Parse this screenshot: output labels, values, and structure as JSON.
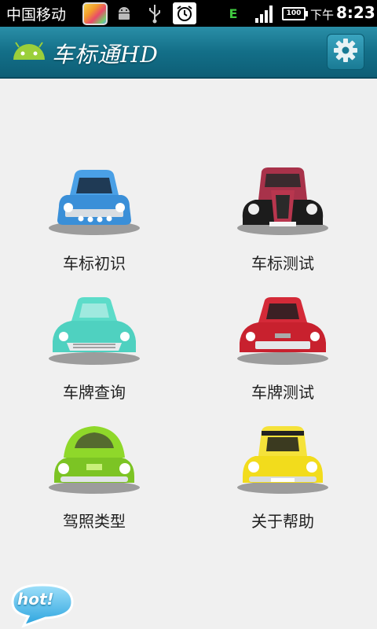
{
  "status_bar": {
    "carrier": "中国移动",
    "network_type": "E",
    "battery_label": "100",
    "time_prefix": "下午",
    "time": "8:23",
    "icons": [
      "app-thumbnail-icon",
      "android-notification-icon",
      "usb-icon",
      "alarm-icon",
      "edge-network-icon",
      "signal-icon",
      "battery-icon"
    ]
  },
  "title_bar": {
    "title": "车标通HD",
    "logo_icon": "android-logo-icon",
    "settings_icon": "gear-icon"
  },
  "menu": {
    "items": [
      {
        "label": "车标初识",
        "car_color": "#3a8fd8"
      },
      {
        "label": "车标测试",
        "car_color": "#a8324a"
      },
      {
        "label": "车牌查询",
        "car_color": "#4fd1c0"
      },
      {
        "label": "车牌测试",
        "car_color": "#c8212e"
      },
      {
        "label": "驾照类型",
        "car_color": "#8fd82a"
      },
      {
        "label": "关于帮助",
        "car_color": "#f2dc1c"
      }
    ]
  },
  "hot_button": {
    "label": "hot!"
  },
  "colors": {
    "title_bar": "#136f88",
    "background": "#f0f0f0"
  }
}
